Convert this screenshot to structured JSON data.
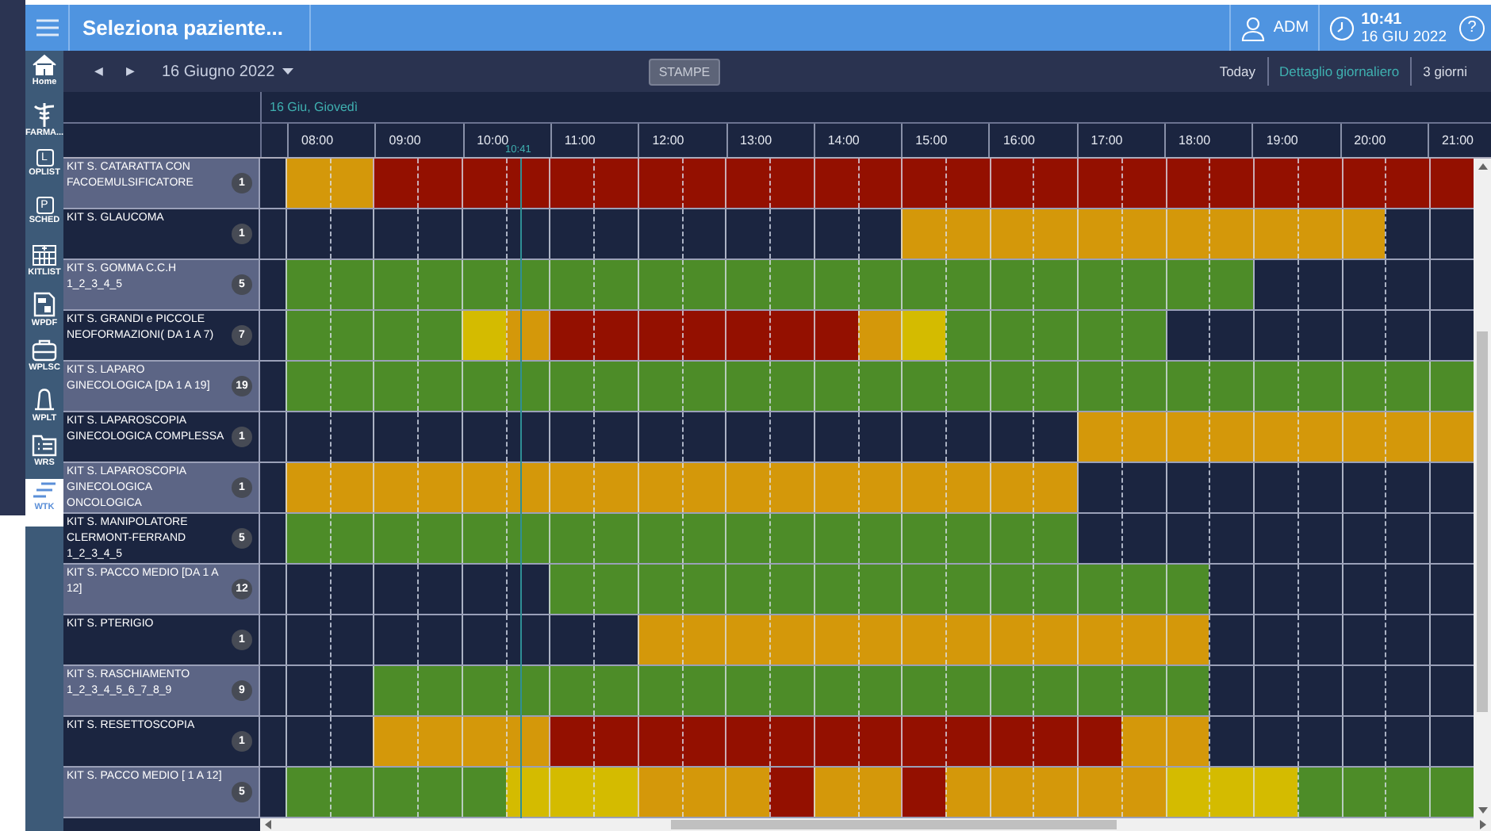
{
  "header": {
    "title": "Seleziona paziente...",
    "user": "ADM",
    "time": "10:41",
    "date": "16 GIU 2022",
    "help": "?"
  },
  "nav": [
    {
      "label": "Home",
      "kind": "home",
      "selected": false
    },
    {
      "label": "FARMA...",
      "kind": "staff",
      "selected": false
    },
    {
      "label": "OPLIST",
      "kind": "letter",
      "letter": "L",
      "selected": false
    },
    {
      "label": "SCHED",
      "kind": "letter",
      "letter": "P",
      "selected": false
    },
    {
      "label": "KITLIST",
      "kind": "grid",
      "selected": false
    },
    {
      "label": "WPDF",
      "kind": "doc",
      "selected": false
    },
    {
      "label": "WPLSC",
      "kind": "case",
      "selected": false
    },
    {
      "label": "WPLT",
      "kind": "bell",
      "selected": false
    },
    {
      "label": "WRS",
      "kind": "list",
      "selected": false
    },
    {
      "label": "WTK",
      "kind": "lines",
      "selected": true
    }
  ],
  "toolbar": {
    "prev": "◀",
    "next": "▶",
    "date": "16 Giugno 2022",
    "print_button": "STAMPE",
    "views": [
      {
        "label": "Today",
        "selected": false
      },
      {
        "label": "Dettaglio giornaliero",
        "selected": true
      },
      {
        "label": "3 giorni",
        "selected": false
      }
    ]
  },
  "timeline": {
    "day": "16 Giu, Giovedì",
    "hours": [
      "08:00",
      "09:00",
      "10:00",
      "11:00",
      "12:00",
      "13:00",
      "14:00",
      "15:00",
      "16:00",
      "17:00",
      "18:00",
      "19:00",
      "20:00",
      "21:00"
    ],
    "now": {
      "label": "10:41",
      "level": 0.197
    }
  },
  "rows": [
    {
      "name": "KIT S. CATARATTA CON FACOEMULSIFICATORE",
      "count": "1",
      "slots": [
        {
          "color": "#d4980a"
        },
        {
          "color": "#d4980a"
        },
        {
          "color": "#941000"
        },
        {
          "color": "#941000"
        },
        {
          "color": "#941000"
        },
        {
          "color": "#941000"
        },
        {
          "color": "#941000"
        },
        {
          "color": "#941000"
        },
        {
          "color": "#941000"
        },
        {
          "color": "#941000"
        },
        {
          "color": "#941000"
        },
        {
          "color": "#941000"
        },
        {
          "color": "#941000"
        },
        {
          "color": "#941000"
        },
        {
          "color": "#941000"
        },
        {
          "color": "#941000"
        },
        {
          "color": "#941000"
        },
        {
          "color": "#941000"
        },
        {
          "color": "#941000"
        },
        {
          "color": "#941000"
        },
        {
          "color": "#941000"
        },
        {
          "color": "#941000"
        },
        {
          "color": "#941000"
        },
        {
          "color": "#941000"
        },
        {
          "color": "#941000"
        },
        {
          "color": "#941000"
        },
        {
          "color": "#941000"
        }
      ]
    },
    {
      "name": "KIT S. GLAUCOMA",
      "count": "1",
      "slots": [
        {
          "color": "#1b2540"
        },
        {
          "color": "#1b2540"
        },
        {
          "color": "#1b2540"
        },
        {
          "color": "#1b2540"
        },
        {
          "color": "#1b2540"
        },
        {
          "color": "#1b2540"
        },
        {
          "color": "#1b2540"
        },
        {
          "color": "#1b2540"
        },
        {
          "color": "#1b2540"
        },
        {
          "color": "#1b2540"
        },
        {
          "color": "#1b2540"
        },
        {
          "color": "#1b2540"
        },
        {
          "color": "#1b2540"
        },
        {
          "color": "#1b2540"
        },
        {
          "color": "#d4980a"
        },
        {
          "color": "#d4980a"
        },
        {
          "color": "#d4980a"
        },
        {
          "color": "#d4980a"
        },
        {
          "color": "#d4980a"
        },
        {
          "color": "#d4980a"
        },
        {
          "color": "#d4980a"
        },
        {
          "color": "#d4980a"
        },
        {
          "color": "#d4980a"
        },
        {
          "color": "#d4980a"
        },
        {
          "color": "#d4980a"
        },
        {
          "color": "#1b2540"
        },
        {
          "color": "#1b2540"
        }
      ]
    },
    {
      "name": "KIT S. GOMMA C.C.H 1_2_3_4_5",
      "count": "5",
      "slots": [
        {
          "color": "#4d8c28"
        },
        {
          "color": "#4d8c28"
        },
        {
          "color": "#4d8c28"
        },
        {
          "color": "#4d8c28"
        },
        {
          "color": "#4d8c28"
        },
        {
          "color": "#4d8c28"
        },
        {
          "color": "#4d8c28"
        },
        {
          "color": "#4d8c28"
        },
        {
          "color": "#4d8c28"
        },
        {
          "color": "#4d8c28"
        },
        {
          "color": "#4d8c28"
        },
        {
          "color": "#4d8c28"
        },
        {
          "color": "#4d8c28"
        },
        {
          "color": "#4d8c28"
        },
        {
          "color": "#4d8c28"
        },
        {
          "color": "#4d8c28"
        },
        {
          "color": "#4d8c28"
        },
        {
          "color": "#4d8c28"
        },
        {
          "color": "#4d8c28"
        },
        {
          "color": "#4d8c28"
        },
        {
          "color": "#4d8c28"
        },
        {
          "color": "#4d8c28"
        },
        {
          "color": "#1b2540"
        },
        {
          "color": "#1b2540"
        },
        {
          "color": "#1b2540"
        },
        {
          "color": "#1b2540"
        },
        {
          "color": "#1b2540"
        }
      ]
    },
    {
      "name": "KIT S. GRANDI e PICCOLE NEOFORMAZIONI( DA 1 A 7)",
      "count": "7",
      "slots": [
        {
          "color": "#4d8c28"
        },
        {
          "color": "#4d8c28"
        },
        {
          "color": "#4d8c28"
        },
        {
          "color": "#4d8c28"
        },
        {
          "color": "#d4bb00"
        },
        {
          "color": "#d4980a"
        },
        {
          "color": "#941000"
        },
        {
          "color": "#941000"
        },
        {
          "color": "#941000"
        },
        {
          "color": "#941000"
        },
        {
          "color": "#941000"
        },
        {
          "color": "#941000"
        },
        {
          "color": "#941000"
        },
        {
          "color": "#d4980a"
        },
        {
          "color": "#d4bb00"
        },
        {
          "color": "#4d8c28"
        },
        {
          "color": "#4d8c28"
        },
        {
          "color": "#4d8c28"
        },
        {
          "color": "#4d8c28"
        },
        {
          "color": "#4d8c28"
        },
        {
          "color": "#1b2540"
        },
        {
          "color": "#1b2540"
        },
        {
          "color": "#1b2540"
        },
        {
          "color": "#1b2540"
        },
        {
          "color": "#1b2540"
        },
        {
          "color": "#1b2540"
        },
        {
          "color": "#1b2540"
        }
      ]
    },
    {
      "name": "KIT S. LAPARO GINECOLOGICA [DA 1 A 19]",
      "count": "19",
      "slots": [
        {
          "color": "#4d8c28"
        },
        {
          "color": "#4d8c28"
        },
        {
          "color": "#4d8c28"
        },
        {
          "color": "#4d8c28"
        },
        {
          "color": "#4d8c28"
        },
        {
          "color": "#4d8c28"
        },
        {
          "color": "#4d8c28"
        },
        {
          "color": "#4d8c28"
        },
        {
          "color": "#4d8c28"
        },
        {
          "color": "#4d8c28"
        },
        {
          "color": "#4d8c28"
        },
        {
          "color": "#4d8c28"
        },
        {
          "color": "#4d8c28"
        },
        {
          "color": "#4d8c28"
        },
        {
          "color": "#4d8c28"
        },
        {
          "color": "#4d8c28"
        },
        {
          "color": "#4d8c28"
        },
        {
          "color": "#4d8c28"
        },
        {
          "color": "#4d8c28"
        },
        {
          "color": "#4d8c28"
        },
        {
          "color": "#4d8c28"
        },
        {
          "color": "#4d8c28"
        },
        {
          "color": "#4d8c28"
        },
        {
          "color": "#4d8c28"
        },
        {
          "color": "#4d8c28"
        },
        {
          "color": "#4d8c28"
        },
        {
          "color": "#4d8c28"
        }
      ]
    },
    {
      "name": "KIT S. LAPAROSCOPIA GINECOLOGICA COMPLESSA",
      "count": "1",
      "slots": [
        {
          "color": "#1b2540"
        },
        {
          "color": "#1b2540"
        },
        {
          "color": "#1b2540"
        },
        {
          "color": "#1b2540"
        },
        {
          "color": "#1b2540"
        },
        {
          "color": "#1b2540"
        },
        {
          "color": "#1b2540"
        },
        {
          "color": "#1b2540"
        },
        {
          "color": "#1b2540"
        },
        {
          "color": "#1b2540"
        },
        {
          "color": "#1b2540"
        },
        {
          "color": "#1b2540"
        },
        {
          "color": "#1b2540"
        },
        {
          "color": "#1b2540"
        },
        {
          "color": "#1b2540"
        },
        {
          "color": "#1b2540"
        },
        {
          "color": "#1b2540"
        },
        {
          "color": "#1b2540"
        },
        {
          "color": "#d4980a"
        },
        {
          "color": "#d4980a"
        },
        {
          "color": "#d4980a"
        },
        {
          "color": "#d4980a"
        },
        {
          "color": "#d4980a"
        },
        {
          "color": "#d4980a"
        },
        {
          "color": "#d4980a"
        },
        {
          "color": "#d4980a"
        },
        {
          "color": "#d4980a"
        }
      ]
    },
    {
      "name": "KIT S. LAPAROSCOPIA GINECOLOGICA ONCOLOGICA",
      "count": "1",
      "slots": [
        {
          "color": "#d4980a"
        },
        {
          "color": "#d4980a"
        },
        {
          "color": "#d4980a"
        },
        {
          "color": "#d4980a"
        },
        {
          "color": "#d4980a"
        },
        {
          "color": "#d4980a"
        },
        {
          "color": "#d4980a"
        },
        {
          "color": "#d4980a"
        },
        {
          "color": "#d4980a"
        },
        {
          "color": "#d4980a"
        },
        {
          "color": "#d4980a"
        },
        {
          "color": "#d4980a"
        },
        {
          "color": "#d4980a"
        },
        {
          "color": "#d4980a"
        },
        {
          "color": "#d4980a"
        },
        {
          "color": "#d4980a"
        },
        {
          "color": "#d4980a"
        },
        {
          "color": "#d4980a"
        },
        {
          "color": "#1b2540"
        },
        {
          "color": "#1b2540"
        },
        {
          "color": "#1b2540"
        },
        {
          "color": "#1b2540"
        },
        {
          "color": "#1b2540"
        },
        {
          "color": "#1b2540"
        },
        {
          "color": "#1b2540"
        },
        {
          "color": "#1b2540"
        },
        {
          "color": "#1b2540"
        }
      ]
    },
    {
      "name": "KIT S. MANIPOLATORE CLERMONT-FERRAND 1_2_3_4_5",
      "count": "5",
      "slots": [
        {
          "color": "#4d8c28"
        },
        {
          "color": "#4d8c28"
        },
        {
          "color": "#4d8c28"
        },
        {
          "color": "#4d8c28"
        },
        {
          "color": "#4d8c28"
        },
        {
          "color": "#4d8c28"
        },
        {
          "color": "#4d8c28"
        },
        {
          "color": "#4d8c28"
        },
        {
          "color": "#4d8c28"
        },
        {
          "color": "#4d8c28"
        },
        {
          "color": "#4d8c28"
        },
        {
          "color": "#4d8c28"
        },
        {
          "color": "#4d8c28"
        },
        {
          "color": "#4d8c28"
        },
        {
          "color": "#4d8c28"
        },
        {
          "color": "#4d8c28"
        },
        {
          "color": "#4d8c28"
        },
        {
          "color": "#4d8c28"
        },
        {
          "color": "#1b2540"
        },
        {
          "color": "#1b2540"
        },
        {
          "color": "#1b2540"
        },
        {
          "color": "#1b2540"
        },
        {
          "color": "#1b2540"
        },
        {
          "color": "#1b2540"
        },
        {
          "color": "#1b2540"
        },
        {
          "color": "#1b2540"
        },
        {
          "color": "#1b2540"
        }
      ]
    },
    {
      "name": "KIT S. PACCO MEDIO [DA 1 A 12]",
      "count": "12",
      "slots": [
        {
          "color": "#1b2540"
        },
        {
          "color": "#1b2540"
        },
        {
          "color": "#1b2540"
        },
        {
          "color": "#1b2540"
        },
        {
          "color": "#1b2540"
        },
        {
          "color": "#1b2540"
        },
        {
          "color": "#4d8c28"
        },
        {
          "color": "#4d8c28"
        },
        {
          "color": "#4d8c28"
        },
        {
          "color": "#4d8c28"
        },
        {
          "color": "#4d8c28"
        },
        {
          "color": "#4d8c28"
        },
        {
          "color": "#4d8c28"
        },
        {
          "color": "#4d8c28"
        },
        {
          "color": "#4d8c28"
        },
        {
          "color": "#4d8c28"
        },
        {
          "color": "#4d8c28"
        },
        {
          "color": "#4d8c28"
        },
        {
          "color": "#4d8c28"
        },
        {
          "color": "#4d8c28"
        },
        {
          "color": "#4d8c28"
        },
        {
          "color": "#1b2540"
        },
        {
          "color": "#1b2540"
        },
        {
          "color": "#1b2540"
        },
        {
          "color": "#1b2540"
        },
        {
          "color": "#1b2540"
        },
        {
          "color": "#1b2540"
        }
      ]
    },
    {
      "name": "KIT S. PTERIGIO",
      "count": "1",
      "slots": [
        {
          "color": "#1b2540"
        },
        {
          "color": "#1b2540"
        },
        {
          "color": "#1b2540"
        },
        {
          "color": "#1b2540"
        },
        {
          "color": "#1b2540"
        },
        {
          "color": "#1b2540"
        },
        {
          "color": "#1b2540"
        },
        {
          "color": "#1b2540"
        },
        {
          "color": "#d4980a"
        },
        {
          "color": "#d4980a"
        },
        {
          "color": "#d4980a"
        },
        {
          "color": "#d4980a"
        },
        {
          "color": "#d4980a"
        },
        {
          "color": "#d4980a"
        },
        {
          "color": "#d4980a"
        },
        {
          "color": "#d4980a"
        },
        {
          "color": "#d4980a"
        },
        {
          "color": "#d4980a"
        },
        {
          "color": "#d4980a"
        },
        {
          "color": "#d4980a"
        },
        {
          "color": "#d4980a"
        },
        {
          "color": "#1b2540"
        },
        {
          "color": "#1b2540"
        },
        {
          "color": "#1b2540"
        },
        {
          "color": "#1b2540"
        },
        {
          "color": "#1b2540"
        },
        {
          "color": "#1b2540"
        }
      ]
    },
    {
      "name": "KIT S. RASCHIAMENTO 1_2_3_4_5_6_7_8_9",
      "count": "9",
      "slots": [
        {
          "color": "#1b2540"
        },
        {
          "color": "#1b2540"
        },
        {
          "color": "#4d8c28"
        },
        {
          "color": "#4d8c28"
        },
        {
          "color": "#4d8c28"
        },
        {
          "color": "#4d8c28"
        },
        {
          "color": "#4d8c28"
        },
        {
          "color": "#4d8c28"
        },
        {
          "color": "#4d8c28"
        },
        {
          "color": "#4d8c28"
        },
        {
          "color": "#4d8c28"
        },
        {
          "color": "#4d8c28"
        },
        {
          "color": "#4d8c28"
        },
        {
          "color": "#4d8c28"
        },
        {
          "color": "#4d8c28"
        },
        {
          "color": "#4d8c28"
        },
        {
          "color": "#4d8c28"
        },
        {
          "color": "#4d8c28"
        },
        {
          "color": "#4d8c28"
        },
        {
          "color": "#4d8c28"
        },
        {
          "color": "#4d8c28"
        },
        {
          "color": "#1b2540"
        },
        {
          "color": "#1b2540"
        },
        {
          "color": "#1b2540"
        },
        {
          "color": "#1b2540"
        },
        {
          "color": "#1b2540"
        },
        {
          "color": "#1b2540"
        }
      ]
    },
    {
      "name": "KIT S. RESETTOSCOPIA",
      "count": "1",
      "slots": [
        {
          "color": "#1b2540"
        },
        {
          "color": "#1b2540"
        },
        {
          "color": "#d4980a"
        },
        {
          "color": "#d4980a"
        },
        {
          "color": "#d4980a"
        },
        {
          "color": "#d4980a"
        },
        {
          "color": "#941000"
        },
        {
          "color": "#941000"
        },
        {
          "color": "#941000"
        },
        {
          "color": "#941000"
        },
        {
          "color": "#941000"
        },
        {
          "color": "#941000"
        },
        {
          "color": "#941000"
        },
        {
          "color": "#941000"
        },
        {
          "color": "#941000"
        },
        {
          "color": "#941000"
        },
        {
          "color": "#941000"
        },
        {
          "color": "#941000"
        },
        {
          "color": "#941000"
        },
        {
          "color": "#d4980a"
        },
        {
          "color": "#d4980a"
        },
        {
          "color": "#1b2540"
        },
        {
          "color": "#1b2540"
        },
        {
          "color": "#1b2540"
        },
        {
          "color": "#1b2540"
        },
        {
          "color": "#1b2540"
        },
        {
          "color": "#1b2540"
        }
      ]
    },
    {
      "name": "KIT S. PACCO MEDIO [ 1 A 12]",
      "count": "5",
      "slots": [
        {
          "color": "#4d8c28"
        },
        {
          "color": "#4d8c28"
        },
        {
          "color": "#4d8c28"
        },
        {
          "color": "#4d8c28"
        },
        {
          "color": "#4d8c28"
        },
        {
          "color": "#d4bb00"
        },
        {
          "color": "#d4bb00"
        },
        {
          "color": "#d4bb00"
        },
        {
          "color": "#d4980a"
        },
        {
          "color": "#d4980a"
        },
        {
          "color": "#d4980a"
        },
        {
          "color": "#941000"
        },
        {
          "color": "#d4980a"
        },
        {
          "color": "#d4980a"
        },
        {
          "color": "#941000"
        },
        {
          "color": "#d4980a"
        },
        {
          "color": "#d4980a"
        },
        {
          "color": "#d4980a"
        },
        {
          "color": "#d4980a"
        },
        {
          "color": "#d4980a"
        },
        {
          "color": "#d4bb00"
        },
        {
          "color": "#d4bb00"
        },
        {
          "color": "#d4bb00"
        },
        {
          "color": "#4d8c28"
        },
        {
          "color": "#4d8c28"
        },
        {
          "color": "#4d8c28"
        },
        {
          "color": "#4d8c28"
        }
      ]
    }
  ]
}
